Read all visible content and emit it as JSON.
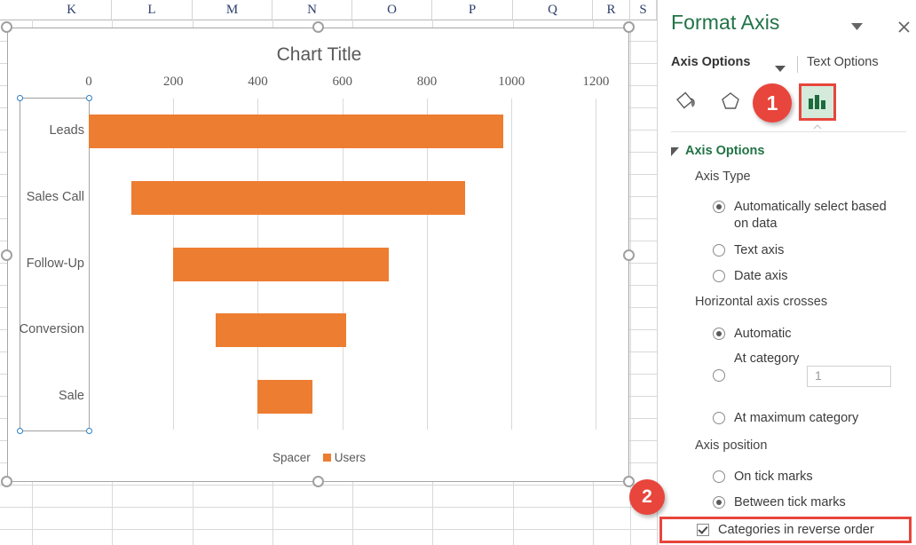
{
  "spreadsheet": {
    "column_headers": [
      "K",
      "L",
      "M",
      "N",
      "O",
      "P",
      "Q",
      "R",
      "S"
    ],
    "scrollbar": {
      "up_arrow_icon": "triangle-up-icon"
    }
  },
  "chart": {
    "title": "Chart Title",
    "accent_color": "#ED7D31",
    "legend": {
      "items": [
        {
          "label": "Spacer",
          "has_swatch": false
        },
        {
          "label": "Users",
          "has_swatch": true,
          "color": "#ED7D31"
        }
      ]
    },
    "selection_handles": 8,
    "category_axis_selected": true
  },
  "chart_data": {
    "type": "bar",
    "orientation": "horizontal",
    "title": "Chart Title",
    "xlabel": "",
    "ylabel": "",
    "xlim": [
      0,
      1260
    ],
    "xticks": [
      0,
      200,
      400,
      600,
      800,
      1000,
      1200
    ],
    "xtick_labels": [
      "0",
      "200",
      "400",
      "600",
      "800",
      "1000",
      "1200"
    ],
    "grid": true,
    "grid_axis": "x",
    "legend_position": "bottom",
    "stacked": true,
    "categories": [
      "Leads",
      "Sales Call",
      "Follow-Up",
      "Conversion",
      "Sale"
    ],
    "series": [
      {
        "name": "Spacer",
        "color": "transparent",
        "values": [
          0,
          100,
          200,
          300,
          400
        ]
      },
      {
        "name": "Users",
        "color": "#ED7D31",
        "values": [
          980,
          790,
          510,
          310,
          130
        ]
      }
    ]
  },
  "pane": {
    "title": "Format Axis",
    "dropdown_icon": "chevron-down-icon",
    "close_icon": "close-icon",
    "tabs": {
      "axis_options": "Axis Options",
      "axis_options_caret": "chevron-down-icon",
      "text_options": "Text Options"
    },
    "icons": [
      {
        "name": "fill-and-line-icon",
        "glyph": "paint-bucket"
      },
      {
        "name": "effects-icon",
        "glyph": "pentagon"
      },
      {
        "name": "size-and-properties-icon",
        "glyph": "size"
      },
      {
        "name": "axis-options-icon",
        "glyph": "bar-chart",
        "selected": true
      }
    ],
    "section": {
      "header": "Axis Options",
      "collapse_icon": "triangle-collapse-icon",
      "groups": [
        {
          "label": "Axis Type",
          "options": [
            {
              "label": "Automatically select based on data",
              "selected": true
            },
            {
              "label": "Text axis",
              "selected": false
            },
            {
              "label": "Date axis",
              "selected": false
            }
          ]
        },
        {
          "label": "Horizontal axis crosses",
          "options": [
            {
              "label": "Automatic",
              "selected": true
            },
            {
              "label": "At category number",
              "selected": false,
              "input_value": "1"
            },
            {
              "label": "At maximum category",
              "selected": false
            }
          ]
        },
        {
          "label": "Axis position",
          "options": [
            {
              "label": "On tick marks",
              "selected": false
            },
            {
              "label": "Between tick marks",
              "selected": true
            }
          ],
          "checkbox": {
            "label": "Categories in reverse order",
            "checked": true,
            "highlighted": true
          }
        }
      ]
    }
  },
  "callouts": [
    {
      "id": "1",
      "label": "1",
      "color": "#E8453C"
    },
    {
      "id": "2",
      "label": "2",
      "color": "#E8453C"
    }
  ]
}
